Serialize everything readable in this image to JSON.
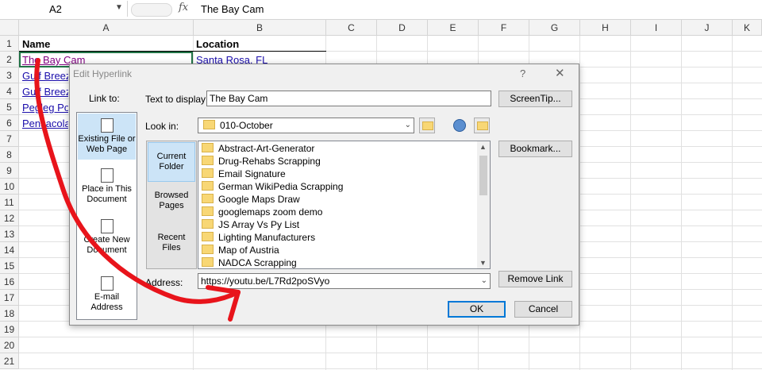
{
  "formula_bar": {
    "name_box": "A2",
    "fx": "fx",
    "value": "The Bay Cam"
  },
  "columns": [
    "A",
    "B",
    "C",
    "D",
    "E",
    "F",
    "G",
    "H",
    "I",
    "J",
    "K"
  ],
  "rows": [
    "1",
    "2",
    "3",
    "4",
    "5",
    "6",
    "7",
    "8",
    "9",
    "10",
    "11",
    "12",
    "13",
    "14",
    "15",
    "16",
    "17",
    "18",
    "19",
    "20",
    "21"
  ],
  "cells": {
    "a1": "Name",
    "b1": "Location",
    "a2": "The Bay Cam",
    "b2": "Santa Rosa, FL",
    "a3": "Gulf Breez",
    "a4": "Gulf Breez",
    "a5": "Pegleg Po",
    "a6": "Pensacola"
  },
  "dialog": {
    "title": "Edit Hyperlink",
    "help": "?",
    "close": "✕",
    "link_to_label": "Link to:",
    "link_to": [
      "Existing File or Web Page",
      "Place in This Document",
      "Create New Document",
      "E-mail Address"
    ],
    "text_to_display_label": "Text to display:",
    "text_to_display": "The Bay Cam",
    "screentip": "ScreenTip...",
    "look_in_label": "Look in:",
    "look_in_value": "010-October",
    "tabs": [
      "Current Folder",
      "Browsed Pages",
      "Recent Files"
    ],
    "files": [
      "Abstract-Art-Generator",
      "Drug-Rehabs Scrapping",
      "Email Signature",
      "German WikiPedia Scrapping",
      "Google Maps Draw",
      "googlemaps zoom demo",
      "JS Array Vs Py List",
      "Lighting Manufacturers",
      "Map of Austria",
      "NADCA Scrapping"
    ],
    "bookmark": "Bookmark...",
    "address_label": "Address:",
    "address": "https://youtu.be/L7Rd2poSVyo",
    "remove_link": "Remove Link",
    "ok": "OK",
    "cancel": "Cancel"
  },
  "annotation_color": "#e8141b"
}
